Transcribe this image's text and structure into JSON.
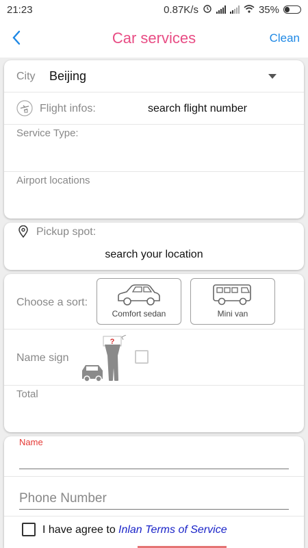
{
  "status_bar": {
    "time": "21:23",
    "net_speed": "0.87K/s",
    "battery": "35%"
  },
  "nav": {
    "title": "Car services",
    "clean_label": "Clean"
  },
  "trip": {
    "city_label": "City",
    "city_value": "Beijing",
    "flight_label": "Flight infos:",
    "flight_value": "search flight number",
    "service_type_label": "Service Type:",
    "airport_label": "Airport locations"
  },
  "pickup": {
    "label": "Pickup spot:",
    "value": "search your location"
  },
  "options": {
    "sort_label": "Choose a sort:",
    "sorts": [
      {
        "label": "Comfort sedan",
        "selected": false
      },
      {
        "label": "Mini van",
        "selected": false
      }
    ],
    "name_sign_label": "Name sign",
    "name_sign_checked": false,
    "total_label": "Total"
  },
  "contact": {
    "name_label": "Name",
    "phone_placeholder": "Phone Number",
    "agree_text": "I have agree to",
    "terms_link": "Inlan Terms of Service",
    "agree_checked": false
  },
  "colors": {
    "title": "#e84c84",
    "accent": "#1e88e5",
    "name_label": "#e53935",
    "terms_link": "#1a24c8"
  }
}
